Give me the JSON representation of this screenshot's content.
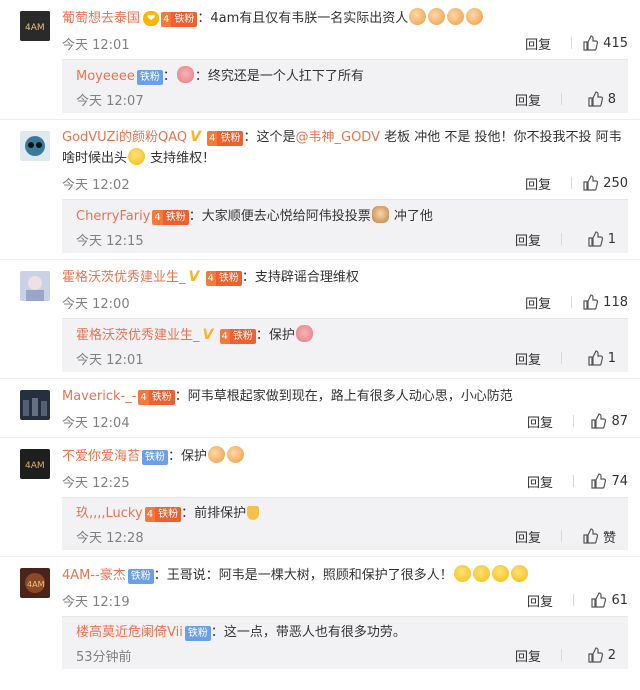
{
  "comments": [
    {
      "user": "葡萄想去泰国",
      "vip": "❤",
      "fans_label": "铁粉",
      "fans_style": "orange",
      "show_v": false,
      "text": "：4am有且仅有韦朕一名实际出资人",
      "emojis_after": [
        "fist",
        "fist",
        "fist",
        "fist"
      ],
      "time": "今天 12:01",
      "reply_label": "回复",
      "likes": "415",
      "avatar_color": "#2a2a2a",
      "reply": {
        "user": "Moyeeee",
        "fans_label": "铁粉",
        "fans_style": "blue",
        "text_before": "：",
        "emoji": "pig",
        "text_after": "：终究还是一个人扛下了所有",
        "time": "今天 12:07",
        "reply_label": "回复",
        "likes": "8"
      }
    },
    {
      "user": "GodVUZi的颜粉QAQ",
      "fans_label": "铁粉",
      "fans_style": "orange",
      "show_v": true,
      "text_1": "：这个是",
      "mention": "@韦神_GODV",
      "text_2": " 老板 冲他 不是 投他！你不投我不投 阿韦",
      "text_3": "啥时候出头",
      "text_4": " 支持维权！",
      "time": "今天 12:02",
      "reply_label": "回复",
      "likes": "250",
      "avatar_color": "#3a6a8a",
      "reply": {
        "user": "CherryFariy",
        "fans_label": "铁粉",
        "fans_style": "orange",
        "text_before": "：大家顺便去心悦给阿伟投投票",
        "emoji": "cat",
        "text_after": " 冲了他",
        "time": "今天 12:15",
        "reply_label": "回复",
        "likes": "1"
      }
    },
    {
      "user": "霍格沃茨优秀建业生_",
      "fans_label": "铁粉",
      "fans_style": "orange",
      "show_v": true,
      "text": "：支持辟谣合理维权",
      "time": "今天 12:00",
      "reply_label": "回复",
      "likes": "118",
      "avatar_color": "#b9c2d6",
      "reply": {
        "user": "霍格沃茨优秀建业生_",
        "fans_label": "铁粉",
        "fans_style": "orange",
        "show_v": true,
        "text_before": "：保护",
        "emoji": "pig",
        "text_after": "",
        "time": "今天 12:01",
        "reply_label": "回复",
        "likes": "1"
      }
    },
    {
      "user": "Maverick-_-",
      "fans_label": "铁粉",
      "fans_style": "orange",
      "text": "：阿韦草根起家做到现在，路上有很多人动心思，小心防范",
      "time": "今天 12:04",
      "reply_label": "回复",
      "likes": "87",
      "avatar_color": "#243040"
    },
    {
      "user": "不爱你爱海苔",
      "fans_label": "铁粉",
      "fans_style": "blue",
      "text": "：保护",
      "time": "今天 12:25",
      "reply_label": "回复",
      "likes": "74",
      "avatar_color": "#1e1e1e",
      "reply": {
        "user": "玖,,,,Lucky",
        "fans_label": "铁粉",
        "fans_style": "orange",
        "text_before": "：前排保护",
        "emoji": "shield",
        "text_after": "",
        "time": "今天 12:28",
        "reply_label": "回复",
        "likes": "赞"
      }
    },
    {
      "user": "4AM--豪杰",
      "fans_label": "铁粉",
      "fans_style": "blue",
      "text": "：王哥说：阿韦是一棵大树，照顾和保护了很多人！",
      "time": "今天 12:19",
      "reply_label": "回复",
      "likes": "61",
      "avatar_color": "#5a2a1a",
      "reply": {
        "user": "楼高莫近危阑倚Vii",
        "fans_label": "铁粉",
        "fans_style": "blue",
        "text_before": "：这一点，带恶人也有很多功劳。",
        "emoji": "",
        "text_after": "",
        "time": "53分钟前",
        "reply_label": "回复",
        "likes": "2"
      }
    }
  ]
}
